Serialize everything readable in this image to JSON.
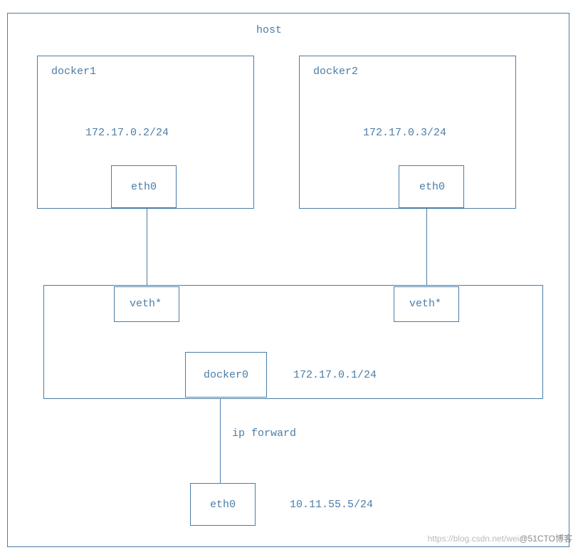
{
  "host": {
    "label": "host"
  },
  "docker1": {
    "name": "docker1",
    "ip": "172.17.0.2/24",
    "interface": "eth0"
  },
  "docker2": {
    "name": "docker2",
    "ip": "172.17.0.3/24",
    "interface": "eth0"
  },
  "veth1": {
    "label": "veth*"
  },
  "veth2": {
    "label": "veth*"
  },
  "bridge": {
    "name": "docker0",
    "ip": "172.17.0.1/24"
  },
  "forward": {
    "label": "ip forward"
  },
  "host_interface": {
    "name": "eth0",
    "ip": "10.11.55.5/24"
  },
  "watermark": {
    "light": "https://blog.csdn.net/wei",
    "dark": "@51CTO博客"
  }
}
